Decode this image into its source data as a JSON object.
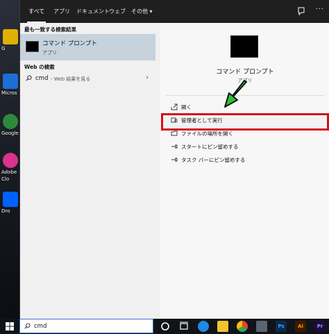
{
  "desktop": {
    "icons": [
      {
        "label": "G",
        "color": "#e0b000"
      },
      {
        "label": "Micros",
        "color": "#1b6fd6"
      },
      {
        "label": "Google",
        "color": "#2c8a3a"
      },
      {
        "label": "Adobe",
        "color": "#d9338c"
      },
      {
        "label": "Clo",
        "color": "#d9338c"
      },
      {
        "label": "Dro",
        "color": "#0061fe"
      }
    ]
  },
  "topbar": {
    "tabs": [
      "すべて",
      "アプリ",
      "ドキュメント",
      "ウェブ",
      "その他 ▾"
    ],
    "more": "···"
  },
  "left": {
    "best_heading": "最も一致する検索結果",
    "best_title": "コマンド プロンプト",
    "best_sub": "アプリ",
    "web_heading": "Web の検索",
    "web_query": "cmd",
    "web_sub": "- Web 結果を見る",
    "web_arrow": "›"
  },
  "right": {
    "title": "コマンド プロンプト",
    "sub": "アプリ",
    "actions": [
      {
        "label": "開く",
        "icon": "open-icon"
      },
      {
        "label": "管理者として実行",
        "icon": "shield-icon"
      },
      {
        "label": "ファイルの場所を開く",
        "icon": "folder-icon"
      },
      {
        "label": "スタートにピン留めする",
        "icon": "pin-icon"
      },
      {
        "label": "タスク バーにピン留めする",
        "icon": "pin-icon"
      }
    ]
  },
  "taskbar": {
    "search_value": "cmd",
    "apps": [
      {
        "name": "cortana-icon",
        "text": "",
        "color": "#101418"
      },
      {
        "name": "task-view-icon",
        "text": "",
        "color": "#101418"
      },
      {
        "name": "edge-icon",
        "text": "",
        "color": "#1e88e5"
      },
      {
        "name": "explorer-icon",
        "text": "",
        "color": "#f2c230"
      },
      {
        "name": "chrome-icon",
        "text": "",
        "color": "#e94235"
      },
      {
        "name": "calculator-icon",
        "text": "",
        "color": "#5a6570"
      },
      {
        "name": "photoshop-icon",
        "text": "Ps",
        "color": "#0b2a4a"
      },
      {
        "name": "illustrator-icon",
        "text": "Ai",
        "color": "#3b1a00"
      },
      {
        "name": "premiere-icon",
        "text": "Pr",
        "color": "#1f0a40"
      }
    ]
  },
  "colors": {
    "highlight_border": "#d4111a",
    "arrow_green": "#2fbf3a",
    "best_match_bg": "#c6d2dc"
  }
}
